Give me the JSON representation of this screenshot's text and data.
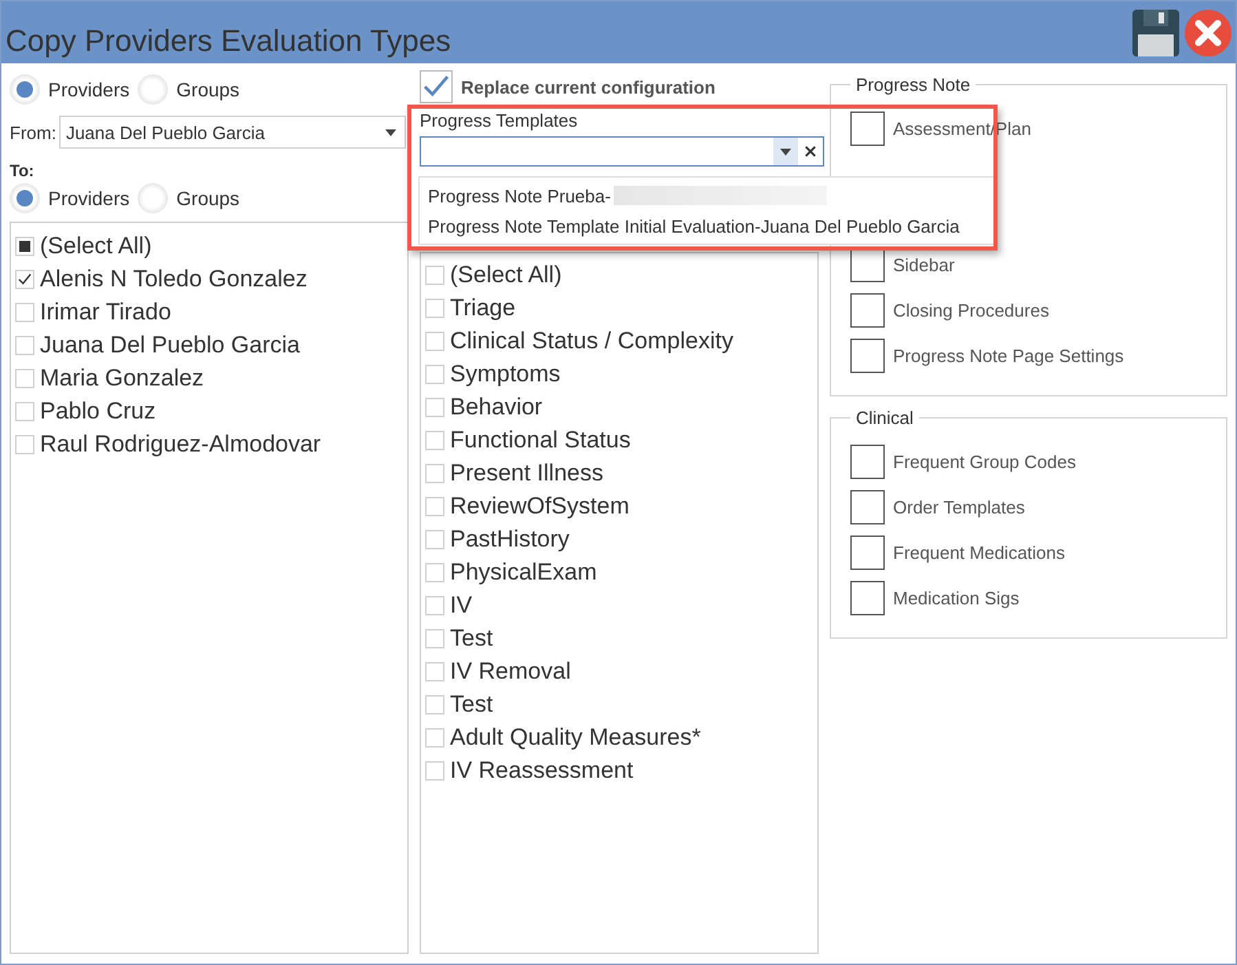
{
  "window": {
    "title": "Copy Providers Evaluation Types"
  },
  "from_source": [
    {
      "label": "Providers",
      "selected": true
    },
    {
      "label": "Groups",
      "selected": false
    }
  ],
  "from": {
    "label": "From:",
    "value": "Juana Del Pueblo Garcia"
  },
  "to": {
    "label": "To:"
  },
  "to_source": [
    {
      "label": "Providers",
      "selected": true
    },
    {
      "label": "Groups",
      "selected": false
    }
  ],
  "providers": [
    {
      "label": "(Select All)",
      "checked": false,
      "indeterminate": true
    },
    {
      "label": "Alenis N Toledo Gonzalez",
      "checked": true,
      "indeterminate": false
    },
    {
      "label": "Irimar Tirado",
      "checked": false,
      "indeterminate": false
    },
    {
      "label": "Juana Del Pueblo Garcia",
      "checked": false,
      "indeterminate": false
    },
    {
      "label": "Maria Gonzalez",
      "checked": false,
      "indeterminate": false
    },
    {
      "label": "Pablo Cruz",
      "checked": false,
      "indeterminate": false
    },
    {
      "label": "Raul Rodriguez-Almodovar",
      "checked": false,
      "indeterminate": false
    }
  ],
  "replace_current": {
    "label": "Replace current configuration",
    "checked": true
  },
  "progress_templates": {
    "label": "Progress Templates",
    "options": [
      {
        "label": "Progress Note Prueba-",
        "redacted": true
      },
      {
        "label": "Progress Note Template Initial Evaluation-Juana Del Pueblo Garcia",
        "redacted": false
      }
    ]
  },
  "evaluation_types": [
    {
      "label": "(Select All)",
      "checked": false,
      "indeterminate": false
    },
    {
      "label": "Triage",
      "checked": false,
      "indeterminate": false
    },
    {
      "label": "Clinical Status / Complexity",
      "checked": false,
      "indeterminate": false
    },
    {
      "label": "Symptoms",
      "checked": false,
      "indeterminate": false
    },
    {
      "label": "Behavior",
      "checked": false,
      "indeterminate": false
    },
    {
      "label": "Functional Status",
      "checked": false,
      "indeterminate": false
    },
    {
      "label": "Present Illness",
      "checked": false,
      "indeterminate": false
    },
    {
      "label": "ReviewOfSystem",
      "checked": false,
      "indeterminate": false
    },
    {
      "label": "PastHistory",
      "checked": false,
      "indeterminate": false
    },
    {
      "label": "PhysicalExam",
      "checked": false,
      "indeterminate": false
    },
    {
      "label": "IV",
      "checked": false,
      "indeterminate": false
    },
    {
      "label": "Test",
      "checked": false,
      "indeterminate": false
    },
    {
      "label": "IV Removal",
      "checked": false,
      "indeterminate": false
    },
    {
      "label": "Test",
      "checked": false,
      "indeterminate": false
    },
    {
      "label": "Adult Quality Measures*",
      "checked": false,
      "indeterminate": false
    },
    {
      "label": "IV Reassessment",
      "checked": false,
      "indeterminate": false
    }
  ],
  "progress_note": {
    "title": "Progress Note",
    "top_items": [
      {
        "label": "Assessment/Plan",
        "checked": false
      }
    ],
    "items": [
      {
        "label": "Sidebar",
        "checked": false
      },
      {
        "label": "Closing Procedures",
        "checked": false
      },
      {
        "label": "Progress Note Page Settings",
        "checked": false
      }
    ]
  },
  "clinical": {
    "title": "Clinical",
    "items": [
      {
        "label": "Frequent Group Codes",
        "checked": false
      },
      {
        "label": "Order Templates",
        "checked": false
      },
      {
        "label": "Frequent Medications",
        "checked": false
      },
      {
        "label": "Medication Sigs",
        "checked": false
      }
    ]
  }
}
